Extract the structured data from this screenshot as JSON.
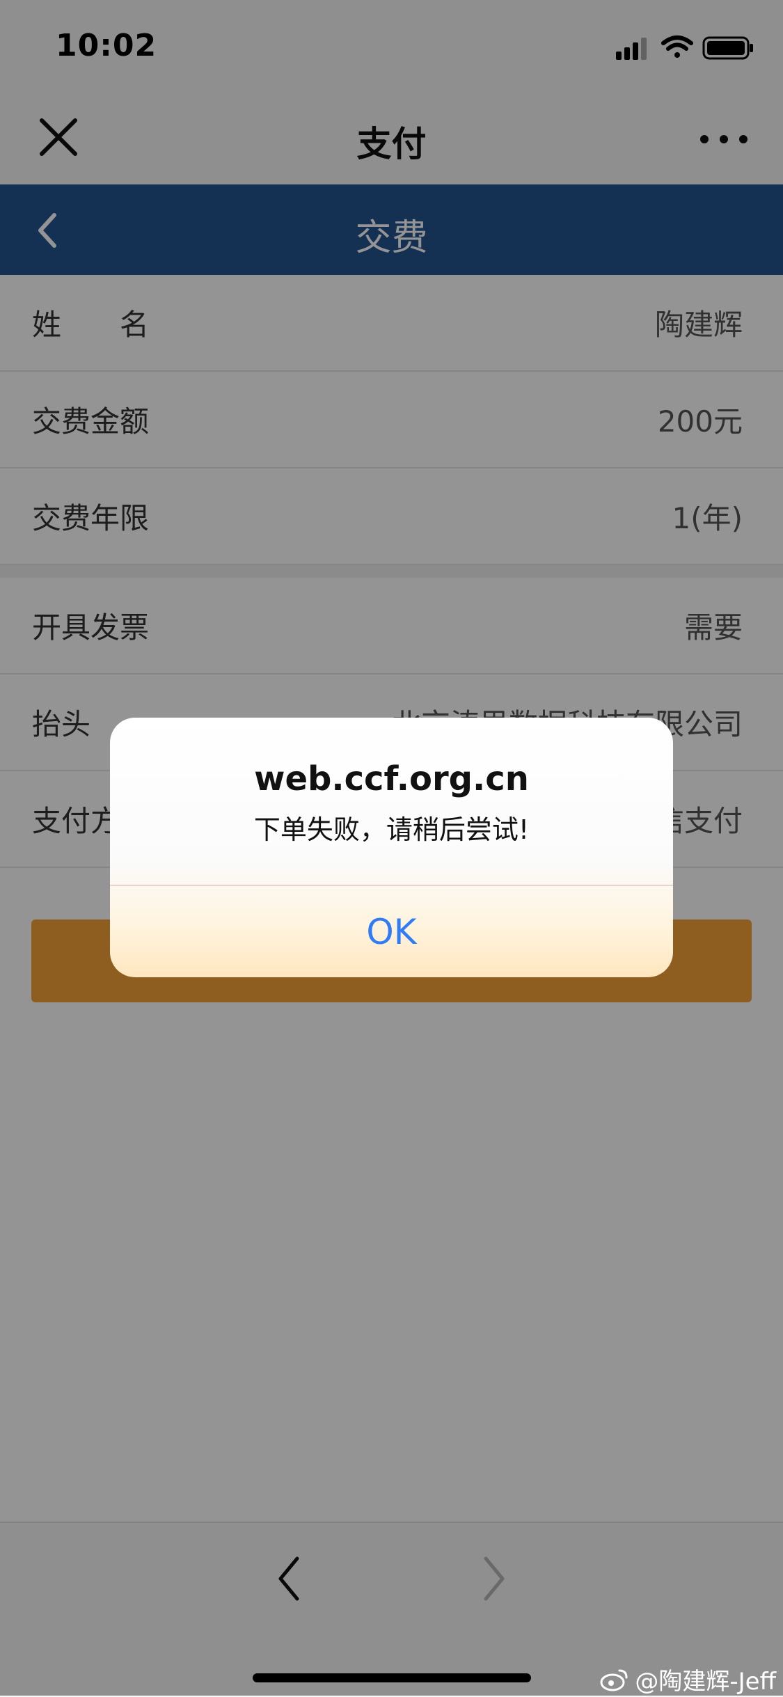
{
  "status_bar": {
    "time": "10:02"
  },
  "nav": {
    "title": "支付"
  },
  "header": {
    "title": "交费"
  },
  "form": {
    "rows": [
      {
        "label": "姓　　名",
        "value": "陶建辉"
      },
      {
        "label": "交费金额",
        "value": "200元"
      },
      {
        "label": "交费年限",
        "value": "1(年)"
      }
    ],
    "rows2": [
      {
        "label": "开具发票",
        "value": "需要"
      },
      {
        "label": "抬头",
        "value": "北京涛思数据科技有限公司"
      },
      {
        "label": "支付方式",
        "value": "微信支付"
      }
    ]
  },
  "alert": {
    "title": "web.ccf.org.cn",
    "message": "下单失败，请稍后尝试!",
    "ok_label": "OK"
  },
  "watermark": {
    "text": "@陶建辉-Jeff"
  },
  "colors": {
    "header_blue": "#24558f",
    "pay_button": "#f5a33a",
    "ok_blue": "#2f7cf6"
  }
}
